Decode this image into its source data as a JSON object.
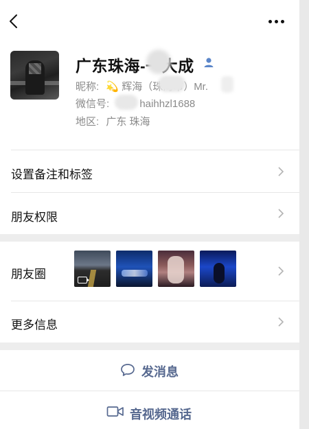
{
  "header": {
    "back_icon": "chevron-left-icon",
    "more_icon": "more-horizontal-icon"
  },
  "profile": {
    "name": "广东珠海-一大成",
    "nickname_label": "昵称:",
    "nickname_value": "💫 辉海（珠海市）Mr.",
    "wechat_id_label": "微信号:",
    "wechat_id_value": "haihhzl1688",
    "region_label": "地区:",
    "region_value": "广东  珠海",
    "badge_icon": "user-icon",
    "accent_color": "#5b86c9"
  },
  "rows": {
    "remark_tags": "设置备注和标签",
    "friend_permissions": "朋友权限",
    "moments": "朋友圈",
    "more_info": "更多信息"
  },
  "actions": {
    "send_message": "发消息",
    "audio_video_call": "音视频通话",
    "message_icon": "chat-bubble-icon",
    "video_icon": "video-camera-icon",
    "action_color": "#56688f"
  }
}
